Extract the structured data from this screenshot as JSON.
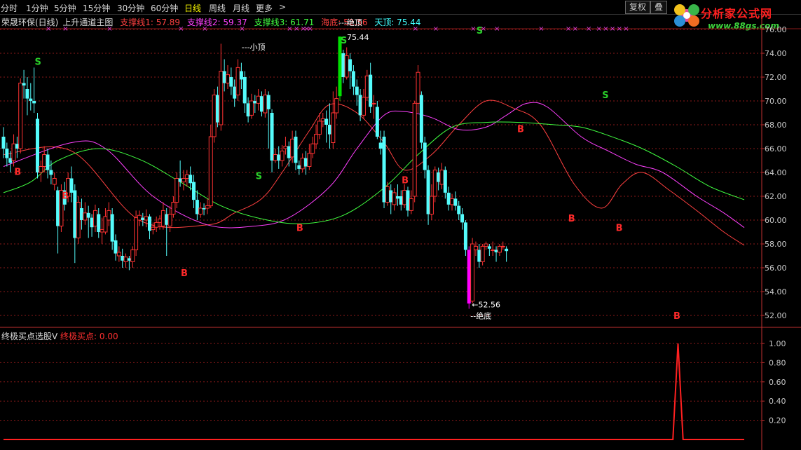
{
  "toolbar": {
    "timeframes": [
      "分时",
      "1分钟",
      "5分钟",
      "15分钟",
      "30分钟",
      "60分钟",
      "日线",
      "周线",
      "月线",
      "更多",
      ">"
    ],
    "active": "日线",
    "fq_label": "复权",
    "die_label": "叠"
  },
  "logo": {
    "text": "分析家公式网",
    "url": "www.88gs.com"
  },
  "legend": {
    "name": "荣晟环保(日线)",
    "indicator": "上升通道主图",
    "items": [
      {
        "label": "支撑线1: 57.89",
        "color": "#ff4040"
      },
      {
        "label": "支撑线2: 59.37",
        "color": "#ff40ff"
      },
      {
        "label": "支撑线3: 61.71",
        "color": "#40ff40"
      },
      {
        "label": "海底: 52.56",
        "color": "#ff4040"
      },
      {
        "label": "天顶: 75.44",
        "color": "#40ffff"
      }
    ]
  },
  "sub_legend": {
    "name": "终极买点选股V",
    "item": "终极买点: 0.00",
    "item_color": "#ff3030"
  },
  "annotations": {
    "small_top": "---小顶",
    "abs_top": "---绝顶",
    "top_value": "75.44",
    "abs_bottom": "--绝底",
    "bottom_value": "52.56",
    "sell": "S",
    "buy": "B",
    "marker": "×"
  },
  "chart_data": {
    "type": "candlestick",
    "y_axis": {
      "range": [
        51,
        76
      ],
      "ticks": [
        52,
        54,
        56,
        58,
        60,
        62,
        64,
        66,
        68,
        70,
        72,
        74,
        76
      ],
      "tick_labels": [
        "52.00",
        "54.00",
        "56.00",
        "58.00",
        "60.00",
        "62.00",
        "64.00",
        "66.00",
        "68.00",
        "70.00",
        "72.00",
        "74.00",
        "76.00"
      ]
    },
    "candles": [
      [
        67,
        66,
        67.8,
        65.2
      ],
      [
        66,
        65.2,
        66.5,
        64.5
      ],
      [
        65.2,
        64.8,
        65.8,
        64
      ],
      [
        65,
        66.4,
        67.2,
        64.5
      ],
      [
        66.4,
        66,
        67,
        65.2
      ],
      [
        66,
        71.5,
        71.9,
        65.6
      ],
      [
        71.5,
        71.3,
        72.6,
        70.2
      ],
      [
        71,
        70.2,
        72,
        68.8
      ],
      [
        70.2,
        70,
        71.5,
        69.2
      ],
      [
        70,
        69.8,
        72.8,
        69
      ],
      [
        68.5,
        64,
        69,
        63.5
      ],
      [
        64,
        64.5,
        65,
        63.2
      ],
      [
        64.5,
        65.5,
        66.2,
        64
      ],
      [
        65.5,
        64.2,
        66,
        63.5
      ],
      [
        64.2,
        63.8,
        65,
        63
      ],
      [
        63,
        63.5,
        64,
        62.5
      ],
      [
        62.5,
        59.5,
        62.8,
        57.2
      ],
      [
        59.5,
        62.5,
        63,
        59
      ],
      [
        62.5,
        61.3,
        63.2,
        60.8
      ],
      [
        62,
        63.5,
        64,
        61.5
      ],
      [
        63.5,
        62.3,
        64.5,
        61.5
      ],
      [
        62.5,
        58.5,
        63,
        56.4
      ],
      [
        58.5,
        61.5,
        62,
        58
      ],
      [
        61,
        60,
        61.8,
        59.2
      ],
      [
        60,
        60.6,
        61.5,
        59.6
      ],
      [
        60.6,
        60.2,
        61.2,
        58.5
      ],
      [
        60.2,
        59.4,
        60.5,
        58.6
      ],
      [
        59.5,
        60.8,
        61.3,
        59
      ],
      [
        60.5,
        59,
        61,
        58.5
      ],
      [
        59,
        59.2,
        60.2,
        58
      ],
      [
        59,
        60.3,
        61,
        58.8
      ],
      [
        60,
        60.8,
        61.5,
        59.5
      ],
      [
        60.5,
        58.2,
        61,
        57.5
      ],
      [
        58.3,
        57.2,
        58.8,
        56.6
      ],
      [
        57,
        57.3,
        57.8,
        56.5
      ],
      [
        57,
        56.6,
        57.6,
        56
      ],
      [
        56.5,
        56.9,
        57.2,
        56
      ],
      [
        56.8,
        56.6,
        57,
        55.8
      ],
      [
        56.5,
        57.5,
        57.8,
        56
      ],
      [
        57.5,
        60.2,
        60.8,
        57
      ],
      [
        60,
        60.4,
        60.8,
        59.5
      ],
      [
        60.2,
        60,
        60.6,
        59.5
      ],
      [
        60,
        60.3,
        60.9,
        59.4
      ],
      [
        60.3,
        59.1,
        60.5,
        58.4
      ],
      [
        59.2,
        59.4,
        59.8,
        58.8
      ],
      [
        59.4,
        59.8,
        60.3,
        59
      ],
      [
        59.8,
        60.1,
        60.4,
        59.2
      ],
      [
        59.5,
        60.8,
        61.5,
        59.2
      ],
      [
        60.5,
        59.6,
        61,
        57
      ],
      [
        59.5,
        60.5,
        61.2,
        59
      ],
      [
        60.5,
        61.5,
        62,
        60.2
      ],
      [
        61.5,
        63.5,
        64,
        61
      ],
      [
        63.5,
        63.2,
        65,
        62.8
      ],
      [
        63.2,
        63.5,
        64.2,
        62.5
      ],
      [
        63.5,
        63.8,
        64.2,
        62.8
      ],
      [
        63.8,
        63.1,
        64.5,
        62.5
      ],
      [
        63.2,
        61.7,
        63.8,
        61
      ],
      [
        61.7,
        60.5,
        62.5,
        60
      ],
      [
        60.5,
        61,
        61.5,
        60.2
      ],
      [
        61,
        60.9,
        61.4,
        60.4
      ],
      [
        61,
        61.2,
        61.8,
        60.5
      ],
      [
        61.2,
        67,
        68,
        61
      ],
      [
        67,
        70.5,
        71,
        66.5
      ],
      [
        70.5,
        68.2,
        71.2,
        67.8
      ],
      [
        68,
        72.5,
        74.8,
        67.5
      ],
      [
        72.5,
        71.5,
        73.5,
        70.8
      ],
      [
        71.5,
        72.2,
        73,
        71
      ],
      [
        72,
        71.2,
        72.8,
        70.5
      ],
      [
        71.2,
        70.2,
        71.8,
        69.5
      ],
      [
        70.5,
        72.8,
        73.5,
        70
      ],
      [
        72.5,
        71.8,
        73.2,
        71
      ],
      [
        72,
        69.8,
        72.5,
        69
      ],
      [
        69.8,
        68.7,
        70.3,
        68.2
      ],
      [
        68.8,
        70,
        70.6,
        68.5
      ],
      [
        70,
        69.8,
        70.5,
        69
      ],
      [
        69.8,
        70.4,
        71,
        69.2
      ],
      [
        70.4,
        69.1,
        70.8,
        68.7
      ],
      [
        69,
        70.5,
        71,
        68.6
      ],
      [
        70.5,
        69.3,
        70.8,
        66
      ],
      [
        69,
        65,
        69.3,
        64
      ],
      [
        65,
        65.5,
        66,
        64.8
      ],
      [
        65.5,
        65,
        66.2,
        64.3
      ],
      [
        65,
        65.8,
        66.3,
        64.5
      ],
      [
        66,
        66.2,
        67,
        65.5
      ],
      [
        66.2,
        65.2,
        66.6,
        64.5
      ],
      [
        65.3,
        66.8,
        67.5,
        64.8
      ],
      [
        67,
        64.8,
        67.5,
        64.2
      ],
      [
        64.6,
        64.3,
        65,
        63.8
      ],
      [
        64.3,
        65.2,
        65.6,
        64
      ],
      [
        65.2,
        64.5,
        65.8,
        63.8
      ],
      [
        64.5,
        65.6,
        66.4,
        64.2
      ],
      [
        65.6,
        66.4,
        67,
        65.2
      ],
      [
        66.4,
        67.2,
        68,
        66
      ],
      [
        67.2,
        68.3,
        69,
        66.8
      ],
      [
        68.3,
        68.5,
        69,
        67.8
      ],
      [
        68.5,
        68,
        69.2,
        66.5
      ],
      [
        68,
        67.2,
        69.8,
        66
      ],
      [
        66.5,
        69,
        70.8,
        66
      ],
      [
        69,
        70.2,
        71.2,
        68.5
      ],
      [
        70.4,
        75.4,
        75.4,
        70
      ],
      [
        74,
        72,
        74.3,
        71.5
      ],
      [
        72,
        73.8,
        74.5,
        71.8
      ],
      [
        73.5,
        72.5,
        74,
        71
      ],
      [
        72.5,
        71.2,
        73,
        70.5
      ],
      [
        71.2,
        70.5,
        71.8,
        69.6
      ],
      [
        70.5,
        68.8,
        71,
        68.3
      ],
      [
        68.8,
        70.3,
        71,
        68.5
      ],
      [
        70.3,
        72.1,
        72.6,
        70
      ],
      [
        72.2,
        69.5,
        73.2,
        69
      ],
      [
        69.8,
        69.8,
        70.5,
        68.5
      ],
      [
        69.5,
        67,
        70,
        66.8
      ],
      [
        66.5,
        66,
        67.5,
        65.5
      ],
      [
        67,
        61.5,
        67.5,
        61
      ],
      [
        61.5,
        62.8,
        63.2,
        61.2
      ],
      [
        62.5,
        61.5,
        63,
        60.5
      ],
      [
        61.3,
        62.3,
        62.7,
        60.8
      ],
      [
        62,
        61.8,
        63,
        61.2
      ],
      [
        62,
        61.3,
        62.5,
        60.8
      ],
      [
        61.3,
        62.5,
        63,
        61
      ],
      [
        62.5,
        60.8,
        62.8,
        60.3
      ],
      [
        60.8,
        61.8,
        62.5,
        60.5
      ],
      [
        62,
        69.8,
        70,
        61.5
      ],
      [
        69.8,
        72.4,
        73,
        69
      ],
      [
        70.5,
        66.5,
        70.8,
        66
      ],
      [
        66.5,
        64.2,
        67,
        63.5
      ],
      [
        64.2,
        60.5,
        64.6,
        59.6
      ],
      [
        60.5,
        62,
        63,
        60
      ],
      [
        62,
        64.2,
        64.5,
        61.5
      ],
      [
        64,
        63.2,
        64.4,
        62.5
      ],
      [
        63,
        64.2,
        64.8,
        62.6
      ],
      [
        64.2,
        62.3,
        64.5,
        61.8
      ],
      [
        62.3,
        61.3,
        62.8,
        60.8
      ],
      [
        61.3,
        61.8,
        62.2,
        60.8
      ],
      [
        61.8,
        61.2,
        62.4,
        60.8
      ],
      [
        61.2,
        60.5,
        61.6,
        60
      ],
      [
        60.5,
        59.8,
        61,
        59.2
      ],
      [
        59.8,
        57.5,
        60,
        57
      ],
      [
        57.5,
        53,
        57.8,
        52.56
      ],
      [
        53.2,
        58,
        58.5,
        53
      ],
      [
        57.5,
        57.8,
        58.2,
        57
      ],
      [
        57.5,
        56.5,
        58,
        56
      ],
      [
        56.5,
        57.8,
        58,
        56.2
      ],
      [
        57.8,
        58,
        58.2,
        57.5
      ],
      [
        57.8,
        57.6,
        58,
        57
      ],
      [
        57.5,
        57.5,
        58.2,
        57
      ],
      [
        57.5,
        57.3,
        57.8,
        56.5
      ],
      [
        57.3,
        57.8,
        58,
        57
      ],
      [
        57.8,
        57.8,
        58.2,
        57.5
      ],
      [
        57.6,
        57.4,
        57.8,
        56.5
      ]
    ],
    "series": [
      {
        "name": "支撑线1",
        "color": "#ff4040",
        "points": [
          [
            0,
            65.5
          ],
          [
            20,
            65.8
          ],
          [
            40,
            60
          ],
          [
            60,
            59.6
          ],
          [
            68,
            60.6
          ],
          [
            76,
            61.8
          ],
          [
            82,
            64
          ],
          [
            90,
            67.5
          ],
          [
            96,
            69.7
          ],
          [
            104,
            69
          ],
          [
            112,
            66.5
          ],
          [
            118,
            64.2
          ],
          [
            126,
            65.5
          ],
          [
            134,
            68
          ],
          [
            142,
            70
          ],
          [
            150,
            69.4
          ],
          [
            158,
            68
          ],
          [
            168,
            63
          ],
          [
            176,
            61
          ],
          [
            182,
            63
          ],
          [
            188,
            64
          ],
          [
            196,
            62.5
          ],
          [
            204,
            60.8
          ],
          [
            212,
            59
          ],
          [
            218,
            57.89
          ]
        ]
      },
      {
        "name": "支撑线2",
        "color": "#ff40ff",
        "points": [
          [
            0,
            64.5
          ],
          [
            20,
            66.5
          ],
          [
            30,
            66
          ],
          [
            44,
            62
          ],
          [
            60,
            59.6
          ],
          [
            74,
            59.5
          ],
          [
            84,
            60.2
          ],
          [
            96,
            62.8
          ],
          [
            104,
            66
          ],
          [
            112,
            68.8
          ],
          [
            118,
            69.1
          ],
          [
            126,
            68.6
          ],
          [
            134,
            67.6
          ],
          [
            142,
            67.8
          ],
          [
            148,
            68.8
          ],
          [
            154,
            69.8
          ],
          [
            160,
            69.5
          ],
          [
            170,
            67
          ],
          [
            178,
            65.8
          ],
          [
            186,
            64.7
          ],
          [
            194,
            64
          ],
          [
            204,
            62
          ],
          [
            212,
            60.6
          ],
          [
            218,
            59.37
          ]
        ]
      },
      {
        "name": "支撑线3",
        "color": "#40ff40",
        "points": [
          [
            0,
            62.3
          ],
          [
            8,
            63.2
          ],
          [
            16,
            65
          ],
          [
            28,
            66
          ],
          [
            40,
            65.1
          ],
          [
            52,
            63.2
          ],
          [
            64,
            61.2
          ],
          [
            76,
            60.1
          ],
          [
            88,
            59.7
          ],
          [
            100,
            60.4
          ],
          [
            112,
            62.7
          ],
          [
            122,
            65.5
          ],
          [
            132,
            67.8
          ],
          [
            142,
            68.2
          ],
          [
            152,
            68.2
          ],
          [
            162,
            68
          ],
          [
            170,
            67.8
          ],
          [
            178,
            67.1
          ],
          [
            188,
            66
          ],
          [
            198,
            64.5
          ],
          [
            208,
            62.8
          ],
          [
            218,
            61.71
          ]
        ]
      },
      {
        "name": "终极买点",
        "color": "#ff3030",
        "points": [
          [
            0,
            0
          ],
          [
            197,
            0
          ],
          [
            198.5,
            1
          ],
          [
            200,
            0
          ],
          [
            218,
            0
          ]
        ]
      }
    ],
    "signals": [
      {
        "type": "S",
        "i": 10,
        "price": 72.8
      },
      {
        "type": "B",
        "i": 4,
        "price": 64.5
      },
      {
        "type": "B",
        "i": 18,
        "price": 62.5
      },
      {
        "type": "B",
        "i": 53,
        "price": 56
      },
      {
        "type": "S",
        "i": 75,
        "price": 63.2
      },
      {
        "type": "B",
        "i": 87,
        "price": 59.8
      },
      {
        "type": "S",
        "i": 100,
        "price": 74.6
      },
      {
        "type": "B",
        "i": 118,
        "price": 63.8
      },
      {
        "type": "S",
        "i": 140,
        "price": 75.4
      },
      {
        "type": "B",
        "i": 152,
        "price": 68.1
      },
      {
        "type": "B",
        "i": 167,
        "price": 60.6
      },
      {
        "type": "S",
        "i": 177,
        "price": 70
      },
      {
        "type": "B",
        "i": 181,
        "price": 59.8
      },
      {
        "type": "B",
        "i": 198,
        "price": 52.4
      }
    ],
    "marker_indices": [
      13,
      18,
      31,
      52,
      59,
      70,
      84,
      86,
      88,
      89,
      90,
      121,
      127,
      138,
      141,
      145,
      158,
      166,
      168,
      172,
      175,
      177,
      179,
      181,
      183
    ]
  }
}
